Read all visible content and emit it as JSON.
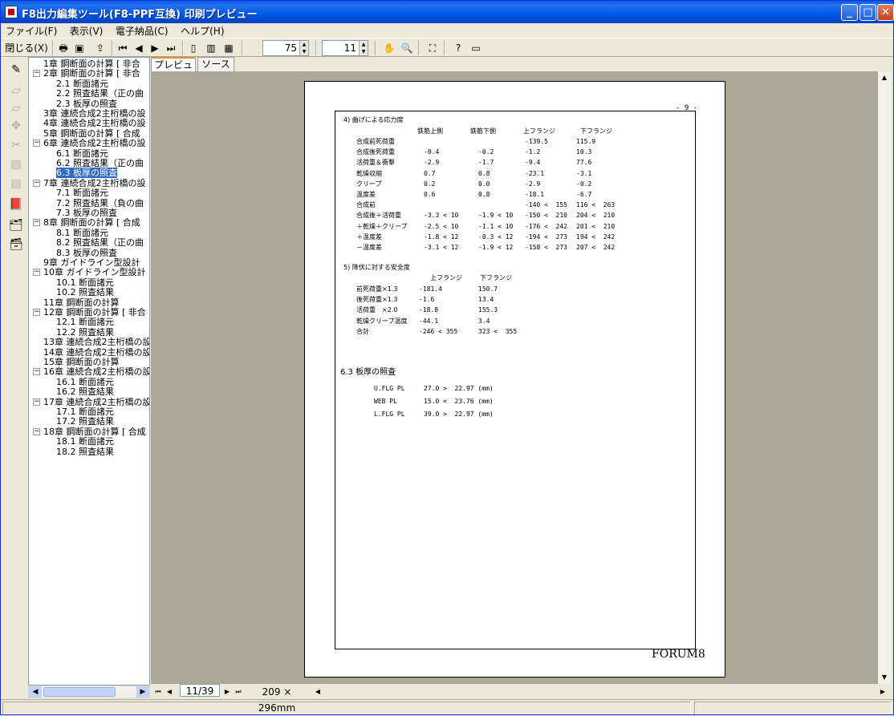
{
  "window": {
    "title": "F8出力編集ツール(F8-PPF互換) 印刷プレビュー",
    "min": "_",
    "max": "□",
    "close": "✕"
  },
  "menu": [
    "ファイル(F)",
    "表示(V)",
    "電子納品(C)",
    "ヘルプ(H)"
  ],
  "toolbar": {
    "close_label": "閉じる(X)",
    "zoom_value": "75",
    "page_value": "11"
  },
  "tabs": [
    "プレビュー",
    "ソース"
  ],
  "tree": [
    {
      "label": "1章 鋼断面の計算 [ 非合",
      "level": 0,
      "exp": ""
    },
    {
      "label": "2章 鋼断面の計算 [ 非合",
      "level": 0,
      "exp": "−"
    },
    {
      "label": "2.1 断面諸元",
      "level": 1,
      "exp": ""
    },
    {
      "label": "2.2 照査結果（正の曲",
      "level": 1,
      "exp": ""
    },
    {
      "label": "2.3 板厚の照査",
      "level": 1,
      "exp": ""
    },
    {
      "label": "3章 連続合成2主桁橋の設",
      "level": 0,
      "exp": ""
    },
    {
      "label": "4章 連続合成2主桁橋の設",
      "level": 0,
      "exp": ""
    },
    {
      "label": "5章 鋼断面の計算 [ 合成",
      "level": 0,
      "exp": ""
    },
    {
      "label": "6章 連続合成2主桁橋の設",
      "level": 0,
      "exp": "−"
    },
    {
      "label": "6.1 断面諸元",
      "level": 1,
      "exp": ""
    },
    {
      "label": "6.2 照査結果（正の曲",
      "level": 1,
      "exp": ""
    },
    {
      "label": "6.3 板厚の照査",
      "level": 1,
      "exp": "",
      "sel": true
    },
    {
      "label": "7章 連続合成2主桁橋の設",
      "level": 0,
      "exp": "−"
    },
    {
      "label": "7.1 断面諸元",
      "level": 1,
      "exp": ""
    },
    {
      "label": "7.2 照査結果（負の曲",
      "level": 1,
      "exp": ""
    },
    {
      "label": "7.3 板厚の照査",
      "level": 1,
      "exp": ""
    },
    {
      "label": "8章 鋼断面の計算 [ 合成",
      "level": 0,
      "exp": "−"
    },
    {
      "label": "8.1 断面諸元",
      "level": 1,
      "exp": ""
    },
    {
      "label": "8.2 照査結果（正の曲",
      "level": 1,
      "exp": ""
    },
    {
      "label": "8.3 板厚の照査",
      "level": 1,
      "exp": ""
    },
    {
      "label": "9章 ガイドライン型設計",
      "level": 0,
      "exp": ""
    },
    {
      "label": "10章 ガイドライン型設計",
      "level": 0,
      "exp": "−"
    },
    {
      "label": "10.1 断面諸元",
      "level": 1,
      "exp": ""
    },
    {
      "label": "10.2 照査結果",
      "level": 1,
      "exp": ""
    },
    {
      "label": "11章 鋼断面の計算",
      "level": 0,
      "exp": ""
    },
    {
      "label": "12章 鋼断面の計算 [ 非合",
      "level": 0,
      "exp": "−"
    },
    {
      "label": "12.1 断面諸元",
      "level": 1,
      "exp": ""
    },
    {
      "label": "12.2 照査結果",
      "level": 1,
      "exp": ""
    },
    {
      "label": "13章 連続合成2主桁橋の設",
      "level": 0,
      "exp": ""
    },
    {
      "label": "14章 連続合成2主桁橋の設",
      "level": 0,
      "exp": ""
    },
    {
      "label": "15章 鋼断面の計算",
      "level": 0,
      "exp": ""
    },
    {
      "label": "16章 連続合成2主桁橋の設",
      "level": 0,
      "exp": "−"
    },
    {
      "label": "16.1 断面諸元",
      "level": 1,
      "exp": ""
    },
    {
      "label": "16.2 照査結果",
      "level": 1,
      "exp": ""
    },
    {
      "label": "17章 連続合成2主桁橋の設",
      "level": 0,
      "exp": "−"
    },
    {
      "label": "17.1 断面諸元",
      "level": 1,
      "exp": ""
    },
    {
      "label": "17.2 照査結果",
      "level": 1,
      "exp": ""
    },
    {
      "label": "18章 鋼断面の計算 [ 合成",
      "level": 0,
      "exp": "−"
    },
    {
      "label": "18.1 断面諸元",
      "level": 1,
      "exp": ""
    },
    {
      "label": "18.2 照査結果",
      "level": 1,
      "exp": ""
    }
  ],
  "page": {
    "page_number": "- 9 -",
    "footer": "FORUM8",
    "sec4_title": "4) 曲げによる応力度",
    "sec4_headers": [
      "鉄筋上側",
      "鉄筋下側",
      "上フランジ",
      "下フランジ"
    ],
    "sec4_rows": [
      [
        "合成前死荷重",
        "",
        "",
        "-139.5",
        "115.9"
      ],
      [
        "合成後死荷重",
        "-0.4",
        "-0.2",
        "-1.2",
        "10.3"
      ],
      [
        "活荷重＆衝撃",
        "-2.9",
        "-1.7",
        "-9.4",
        "77.6"
      ],
      [
        "乾燥収縮",
        "0.7",
        "0.8",
        "-23.1",
        "-3.1"
      ],
      [
        "クリープ",
        "0.2",
        "0.0",
        "-2.9",
        "-0.2"
      ],
      [
        "温度差",
        "0.6",
        "0.8",
        "-18.1",
        "-6.7"
      ],
      [
        "合成前",
        "",
        "",
        "-140 <  155",
        "116 <  263"
      ],
      [
        "合成後＋活荷重",
        "-3.3 < 10",
        "-1.9 < 10",
        "-150 <  210",
        "204 <  210"
      ],
      [
        "＋乾燥＋クリープ",
        "-2.5 < 10",
        "-1.1 < 10",
        "-176 <  242",
        "201 <  210"
      ],
      [
        "＋温度差",
        "-1.8 < 12",
        "-0.3 < 12",
        "-194 <  273",
        "194 <  242"
      ],
      [
        "－温度差",
        "-3.1 < 12",
        "-1.9 < 12",
        "-158 <  273",
        "207 <  242"
      ]
    ],
    "sec5_title": "5) 降伏に対する安全度",
    "sec5_headers": [
      "上フランジ",
      "下フランジ"
    ],
    "sec5_rows": [
      [
        "前死荷重×1.3",
        "-181.4",
        "150.7"
      ],
      [
        "後死荷重×1.3",
        "-1.6",
        "13.4"
      ],
      [
        "活荷重　×2.0",
        "-18.8",
        "155.3"
      ],
      [
        "乾燥クリープ温度",
        "-44.1",
        "3.4"
      ],
      [
        "合計",
        "-246 < 355",
        "323 <  355"
      ]
    ],
    "sec63_title": "6.3 板厚の照査",
    "sec63_rows": [
      [
        "U.FLG PL",
        "27.0 >  22.97 (mm)"
      ],
      [
        "WEB PL",
        "15.0 <  23.76 (mm)"
      ],
      [
        "L.FLG PL",
        "39.0 >  22.97 (mm)"
      ]
    ]
  },
  "status": {
    "page_indicator": "11/39",
    "paper_size": "209 × 296mm"
  }
}
